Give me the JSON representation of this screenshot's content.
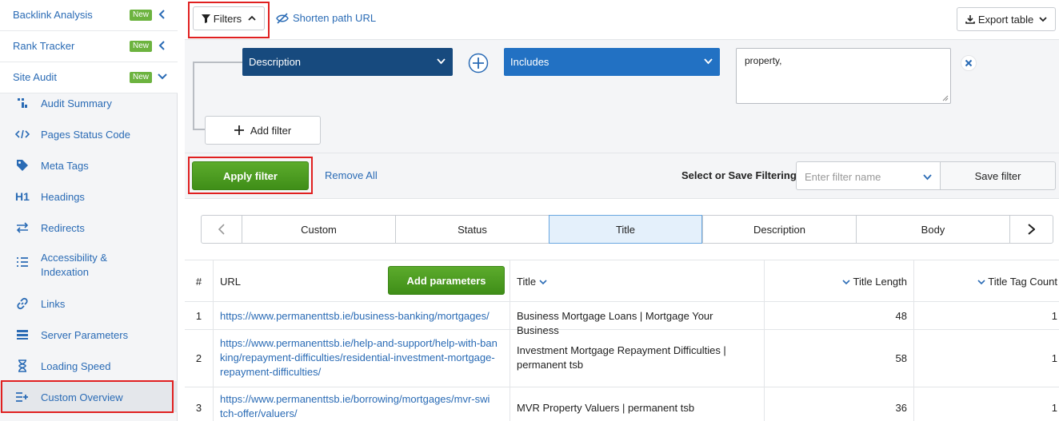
{
  "sidebar": {
    "top_items": [
      {
        "label": "Backlink Analysis",
        "badge": "New",
        "chevron": "left"
      },
      {
        "label": "Rank Tracker",
        "badge": "New",
        "chevron": "left"
      },
      {
        "label": "Site Audit",
        "badge": "New",
        "chevron": "down"
      }
    ],
    "items": [
      {
        "label": "Audit Summary",
        "icon": "audit-summary-icon"
      },
      {
        "label": "Pages Status Code",
        "icon": "code-icon"
      },
      {
        "label": "Meta Tags",
        "icon": "tag-icon"
      },
      {
        "label": "Headings",
        "icon": "h1-icon",
        "icon_text": "H1"
      },
      {
        "label": "Redirects",
        "icon": "redirect-arrows-icon"
      },
      {
        "label": "Accessibility &",
        "label2": "Indexation",
        "icon": "list-icon"
      },
      {
        "label": "Links",
        "icon": "link-icon"
      },
      {
        "label": "Server Parameters",
        "icon": "server-icon"
      },
      {
        "label": "Loading Speed",
        "icon": "hourglass-icon"
      },
      {
        "label": "Custom Overview",
        "icon": "custom-list-icon"
      }
    ],
    "active": "Custom Overview"
  },
  "toolbar": {
    "filters_label": "Filters",
    "shorten_label": "Shorten path URL",
    "export_label": "Export table"
  },
  "filter": {
    "field": "Description",
    "operator": "Includes",
    "value": "property,",
    "add_filter_label": "Add filter"
  },
  "apply": {
    "apply_label": "Apply filter",
    "remove_all_label": "Remove All",
    "select_save_label": "Select or Save Filtering:",
    "filter_name_placeholder": "Enter filter name",
    "save_label": "Save filter"
  },
  "tabs": [
    "Custom",
    "Status",
    "Title",
    "Description",
    "Body"
  ],
  "active_tab": "Title",
  "table": {
    "headers": {
      "num": "#",
      "url": "URL",
      "add_params": "Add parameters",
      "title": "Title",
      "title_length": "Title Length",
      "title_tag_count": "Title Tag Count"
    },
    "rows": [
      {
        "num": "1",
        "url": [
          "https://www.permanenttsb.ie/business-banking/mortgages/"
        ],
        "title": [
          "Business Mortgage Loans | Mortgage Your Business"
        ],
        "length": "48",
        "count": "1"
      },
      {
        "num": "2",
        "url": [
          "https://www.permanenttsb.ie/help-and-support/help-with-ban",
          "king/repayment-difficulties/residential-investment-mortgage-",
          "repayment-difficulties/"
        ],
        "title": [
          "Investment Mortgage Repayment Difficulties |",
          "permanent tsb"
        ],
        "length": "58",
        "count": "1"
      },
      {
        "num": "3",
        "url": [
          "https://www.permanenttsb.ie/borrowing/mortgages/mvr-swi",
          "tch-offer/valuers/"
        ],
        "title": [
          "MVR Property Valuers | permanent tsb"
        ],
        "length": "36",
        "count": "1"
      }
    ]
  },
  "colors": {
    "accent": "#2a6bb5",
    "green": "#4a9c22",
    "highlight": "#e02020",
    "dark_dropdown": "#174a7e",
    "blue_dropdown": "#2271c3"
  }
}
